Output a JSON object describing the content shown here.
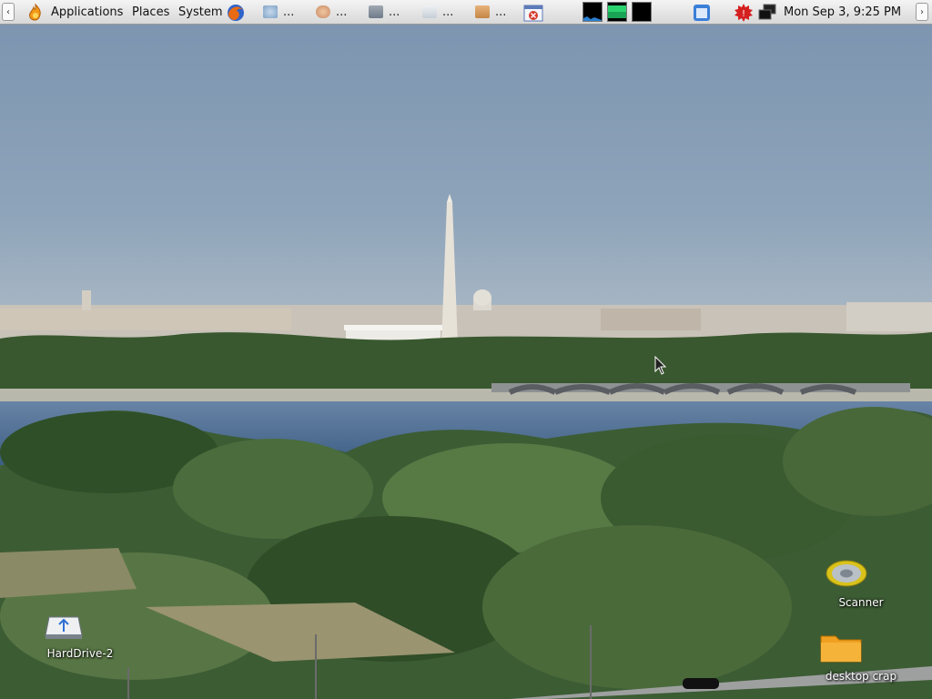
{
  "panel": {
    "left_arrow": "‹",
    "right_arrow": "›",
    "menus": [
      "Applications",
      "Places",
      "System"
    ],
    "tasks": [
      {
        "icon": "web-browser-task-icon",
        "label": "..."
      },
      {
        "icon": "user-task-icon",
        "label": "..."
      },
      {
        "icon": "image-viewer-task-icon",
        "label": "..."
      },
      {
        "icon": "dialog-task-icon",
        "label": "..."
      },
      {
        "icon": "folder-task-icon",
        "label": "..."
      }
    ],
    "clock": "Mon Sep  3,  9:25 PM"
  },
  "desktop_icons": {
    "harddrive": "HardDrive-2",
    "scanner": "Scanner",
    "folder": "desktop crap"
  },
  "colors": {
    "panel_bg": "#e6e6e6",
    "sky": "#8ea4ba",
    "river": "#4a6a8e",
    "trees": "#3f5f3a",
    "folder": "#f0a020"
  }
}
